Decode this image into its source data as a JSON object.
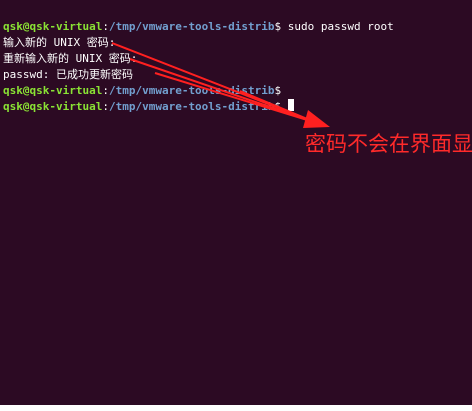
{
  "terminal": {
    "prompt": {
      "user_host": "qsk@qsk-virtual",
      "separator": ":",
      "path": "/tmp/vmware-tools-distrib",
      "symbol": "$ "
    },
    "command": "sudo passwd root",
    "outputs": [
      "输入新的 UNIX 密码:",
      "重新输入新的 UNIX 密码:",
      "passwd: 已成功更新密码"
    ]
  },
  "annotation": {
    "text": "密码不会在界面显示",
    "color": "#ff2a2a"
  },
  "colors": {
    "background": "#2c0a23",
    "user_host": "#8ae234",
    "path": "#729fcf",
    "text": "#ffffff"
  }
}
